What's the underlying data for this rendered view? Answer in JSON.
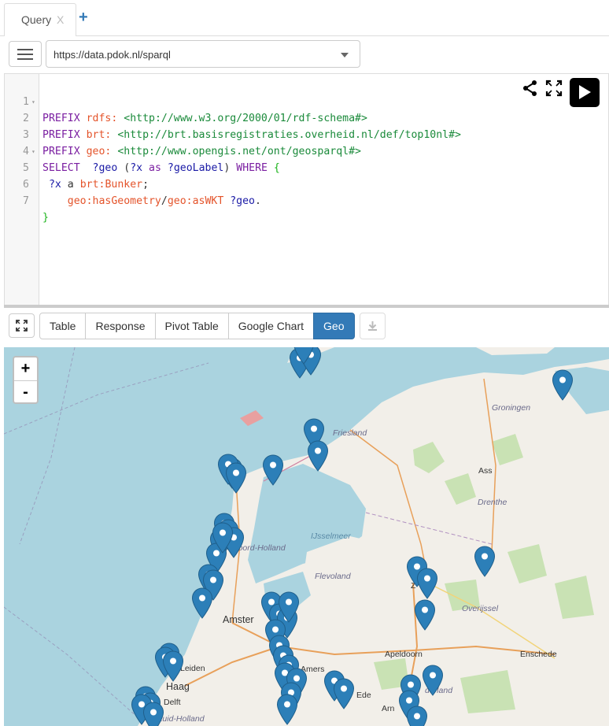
{
  "tabs": [
    {
      "label": "Query",
      "close": "X"
    }
  ],
  "tab_add": "+",
  "endpoint": {
    "value": "https://data.pdok.nl/sparql"
  },
  "editor": {
    "lines": [
      {
        "n": "1",
        "fold": "▾"
      },
      {
        "n": "2",
        "fold": ""
      },
      {
        "n": "3",
        "fold": ""
      },
      {
        "n": "4",
        "fold": "▾"
      },
      {
        "n": "5",
        "fold": ""
      },
      {
        "n": "6",
        "fold": ""
      },
      {
        "n": "7",
        "fold": ""
      }
    ],
    "code": {
      "l1": {
        "kw": "PREFIX",
        "pfx": "rdfs:",
        "iri": "<http://www.w3.org/2000/01/rdf-schema#>"
      },
      "l2": {
        "kw": "PREFIX",
        "pfx": "brt:",
        "iri": "<http://brt.basisregistraties.overheid.nl/def/top10nl#>"
      },
      "l3": {
        "kw": "PREFIX",
        "pfx": "geo:",
        "iri": "<http://www.opengis.net/ont/geosparql#>"
      },
      "l4": {
        "select": "SELECT",
        "v1": "?geo",
        "p1": "(",
        "v2": "?x",
        "as": "as",
        "v3": "?geoLabel",
        "p2": ")",
        "where": "WHERE",
        "brace": "{"
      },
      "l5": {
        "v": "?x",
        "a": "a",
        "cls": "brt:Bunker",
        "end": ";"
      },
      "l6": {
        "p1": "geo:hasGeometry",
        "slash": "/",
        "p2": "geo:asWKT",
        "v": "?geo",
        "end": "."
      },
      "l7": {
        "brace": "}"
      }
    }
  },
  "results": {
    "plugins": [
      "Table",
      "Response",
      "Pivot Table",
      "Google Chart",
      "Geo"
    ],
    "active_plugin": "Geo"
  },
  "map": {
    "zoom_in": "+",
    "zoom_out": "-",
    "labels": {
      "groningen": "Groningen",
      "friesland": "Friesland",
      "drenthe": "Drenthe",
      "assen": "Ass",
      "ijsselmeer": "IJsselmeer",
      "noord_holland": "Noord-Holland",
      "flevoland": "Flevoland",
      "zwolle": "Z",
      "overijssel": "Overijssel",
      "amsterdam": "Amster",
      "apeldoorn": "Apeldoorn",
      "enschede": "Enschede",
      "leiden": "Leiden",
      "den_haag": "Haag",
      "amersfoort": "Amers",
      "ede": "Ede",
      "delft": "Delft",
      "gelderland": "derland",
      "arnhem": "Arn",
      "zuid_holland": "Zuid-Holland"
    },
    "marker_color": "#2c7fb8"
  }
}
